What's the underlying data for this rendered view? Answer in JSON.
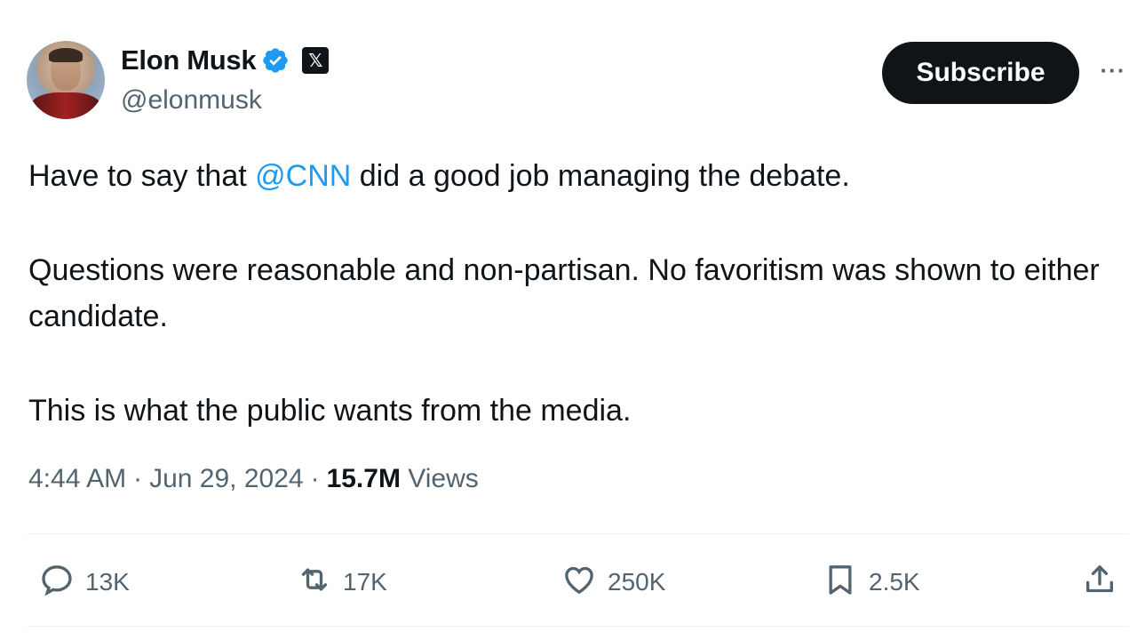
{
  "author": {
    "name": "Elon Musk",
    "handle": "@elonmusk",
    "x_badge": "𝕏"
  },
  "subscribe_label": "Subscribe",
  "more_label": "···",
  "tweet": {
    "line1_pre": "Have to say that ",
    "line1_mention": "@CNN",
    "line1_post": " did a good job managing the debate.",
    "paragraph2": "Questions were reasonable and non-partisan. No favoritism was shown to either candidate.",
    "paragraph3": "This is what the public wants from the media."
  },
  "meta": {
    "time": "4:44 AM",
    "sep1": "·",
    "date": "Jun 29, 2024",
    "sep2": "·",
    "views_count": "15.7M",
    "views_label": "Views"
  },
  "actions": {
    "replies": "13K",
    "reposts": "17K",
    "likes": "250K",
    "bookmarks": "2.5K"
  },
  "icons": {
    "verified": "verified-badge-icon",
    "reply": "reply-icon",
    "repost": "repost-icon",
    "like": "heart-icon",
    "bookmark": "bookmark-icon",
    "share": "share-icon"
  },
  "colors": {
    "accent": "#1d9bf0",
    "text": "#0f1419",
    "secondary": "#536471",
    "button_bg": "#0f1419"
  }
}
